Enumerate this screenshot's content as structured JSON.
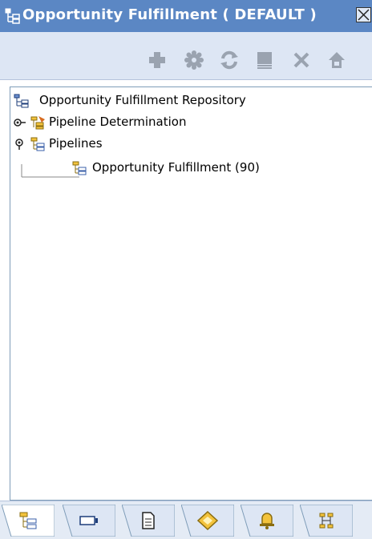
{
  "window": {
    "title": "Opportunity Fulfillment ( DEFAULT )",
    "close_icon": "close-icon"
  },
  "toolbar": {
    "buttons": [
      {
        "name": "add",
        "icon": "plus-icon",
        "enabled": false
      },
      {
        "name": "details",
        "icon": "gear-icon",
        "enabled": false
      },
      {
        "name": "refresh",
        "icon": "refresh-icon",
        "enabled": false
      },
      {
        "name": "save",
        "icon": "save-icon",
        "enabled": false
      },
      {
        "name": "delete",
        "icon": "delete-icon",
        "enabled": false
      },
      {
        "name": "export",
        "icon": "export-icon",
        "enabled": false
      }
    ]
  },
  "tree": {
    "root": {
      "label": "Opportunity Fulfillment Repository",
      "icon": "repository-icon"
    },
    "items": [
      {
        "label": "Pipeline Determination",
        "icon": "pipeline-determination-icon",
        "expanded": false
      },
      {
        "label": "Pipelines",
        "icon": "pipelines-icon",
        "expanded": true,
        "children": [
          {
            "label": "Opportunity Fulfillment (90)",
            "icon": "pipeline-icon"
          }
        ]
      }
    ]
  },
  "tabs": [
    {
      "name": "pipelines-tab",
      "icon": "pipelines-icon",
      "selected": true
    },
    {
      "name": "screen-tab",
      "icon": "screen-icon",
      "selected": false
    },
    {
      "name": "document-tab",
      "icon": "document-icon",
      "selected": false
    },
    {
      "name": "condition-tab",
      "icon": "diamond-icon",
      "selected": false
    },
    {
      "name": "alert-tab",
      "icon": "bell-icon",
      "selected": false
    },
    {
      "name": "services-tab",
      "icon": "services-icon",
      "selected": false
    }
  ],
  "colors": {
    "titlebar": "#5b87c4",
    "toolbar": "#dde6f4",
    "tabstrip": "#e4ebf5",
    "panel_border": "#7f9db9"
  }
}
